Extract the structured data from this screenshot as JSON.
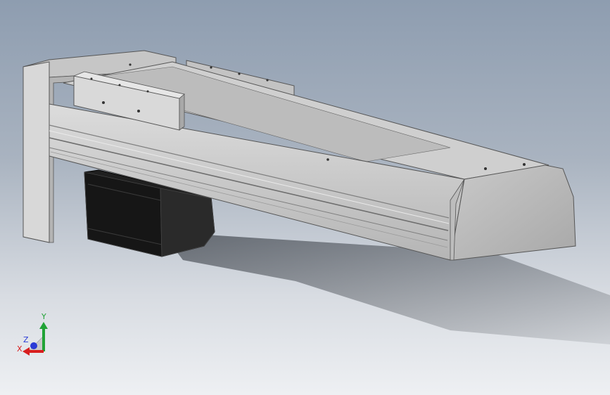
{
  "triad": {
    "x_label": "X",
    "y_label": "Y",
    "z_label": "Z",
    "colors": {
      "x": "#d81e1e",
      "y": "#21a336",
      "z": "#2a3bd6"
    }
  },
  "viewport": {
    "background_top": "#8e9db0",
    "background_bottom": "#eef0f3"
  },
  "model": {
    "icon": "linear-actuator-3d-model",
    "colors": {
      "aluminum_light": "#d2d2d2",
      "aluminum_mid": "#b8b8b8",
      "aluminum_dark": "#8c8c8c",
      "motor": "#1b1b1b",
      "shadow": "#3a3f46"
    }
  }
}
